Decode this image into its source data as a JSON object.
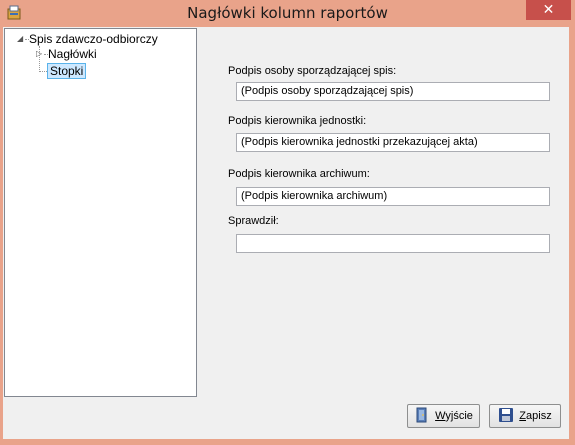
{
  "window": {
    "title": "Nagłówki kolumn raportów",
    "close_glyph": "✕"
  },
  "tree": {
    "root_label": "Spis zdawczo-odbiorczy",
    "children": [
      {
        "label": "Nagłówki",
        "expandable": true
      },
      {
        "label": "Stopki",
        "selected": true
      }
    ]
  },
  "form": {
    "fields": [
      {
        "label": "Podpis osoby sporządzającej spis:",
        "value": "(Podpis osoby sporządzającej spis)"
      },
      {
        "label": "Podpis kierownika jednostki:",
        "value": "(Podpis kierownika jednostki przekazującej akta)"
      },
      {
        "label": "Podpis kierownika archiwum:",
        "value": "(Podpis kierownika archiwum)"
      },
      {
        "label": "Sprawdził:",
        "value": ""
      }
    ]
  },
  "buttons": {
    "exit": {
      "mnemonic": "W",
      "rest": "yjście",
      "icon": "exit-door-icon"
    },
    "save": {
      "mnemonic": "Z",
      "rest": "apisz",
      "icon": "floppy-disk-icon"
    }
  },
  "colors": {
    "titlebar": "#e9a38a",
    "close": "#c7504b",
    "selection": "#cde8ff",
    "selection_border": "#5ab3ea"
  }
}
